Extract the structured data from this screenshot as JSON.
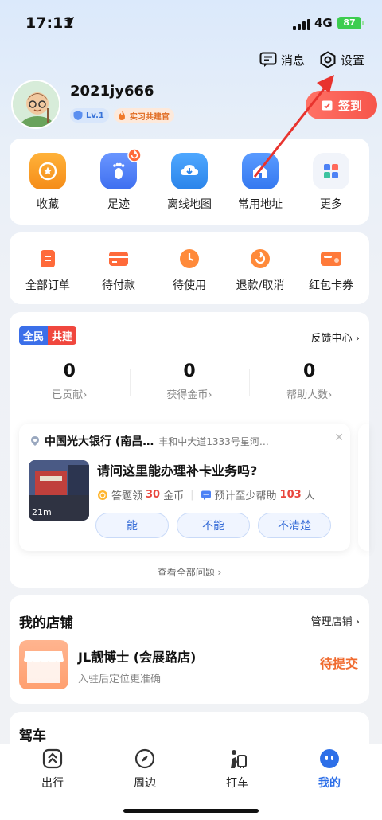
{
  "status_bar": {
    "time": "17:11",
    "network": "4G",
    "battery": "87"
  },
  "top_actions": {
    "messages": "消息",
    "settings": "设置"
  },
  "profile": {
    "username": "2021jy666",
    "level": "Lv.1",
    "tag": "实习共建官",
    "signin": "签到"
  },
  "shortcuts": [
    {
      "label": "收藏",
      "icon": "star-icon",
      "color": "#f59a23"
    },
    {
      "label": "足迹",
      "icon": "footprint-icon",
      "color": "#4d7cf3"
    },
    {
      "label": "离线地图",
      "icon": "download-map-icon",
      "color": "#2f8ff0"
    },
    {
      "label": "常用地址",
      "icon": "home-address-icon",
      "color": "#3f86f5"
    },
    {
      "label": "更多",
      "icon": "grid-more-icon",
      "color": "#eef2fa"
    }
  ],
  "orders": [
    {
      "label": "全部订单",
      "icon": "order-list-icon"
    },
    {
      "label": "待付款",
      "icon": "wallet-icon"
    },
    {
      "label": "待使用",
      "icon": "clock-icon"
    },
    {
      "label": "退款/取消",
      "icon": "refund-icon"
    },
    {
      "label": "红包卡券",
      "icon": "coupon-icon"
    }
  ],
  "contribution": {
    "tag_left": "全民",
    "tag_right": "共建",
    "feedback": "反馈中心 ›",
    "stats": [
      {
        "value": "0",
        "label": "已贡献›"
      },
      {
        "value": "0",
        "label": "获得金币›"
      },
      {
        "value": "0",
        "label": "帮助人数›"
      }
    ],
    "question": {
      "place": "中国光大银行 (南昌…",
      "address": "丰和中大道1333号星河…",
      "duration": "21m",
      "title": "请问这里能办理补卡业务吗?",
      "reward_prefix": "答题领",
      "reward_num": "30",
      "reward_unit": "金币",
      "help_prefix": "预计至少帮助",
      "help_num": "103",
      "help_unit": "人",
      "answers": [
        "能",
        "不能",
        "不清楚"
      ]
    },
    "view_all": "查看全部问题 ›"
  },
  "shop": {
    "title": "我的店铺",
    "manage": "管理店铺 ›",
    "name": "JL靓博士 (会展路店)",
    "subtitle": "入驻后定位更准确",
    "status": "待提交"
  },
  "drive": {
    "title": "驾车"
  },
  "tabbar": [
    {
      "label": "出行",
      "icon": "travel-icon",
      "active": false
    },
    {
      "label": "周边",
      "icon": "compass-icon",
      "active": false
    },
    {
      "label": "打车",
      "icon": "taxi-icon",
      "active": false
    },
    {
      "label": "我的",
      "icon": "profile-face-icon",
      "active": true
    }
  ]
}
